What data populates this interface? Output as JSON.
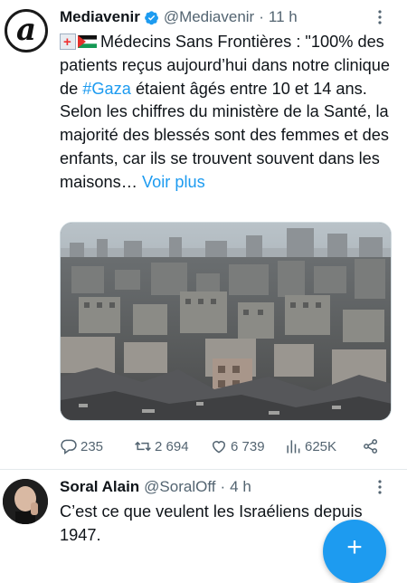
{
  "tweet": {
    "author_name": "Mediavenir",
    "author_handle": "@Mediavenir",
    "separator": "·",
    "time": "11 h",
    "avatar_glyph": "a",
    "text_prefix": "Médecins Sans Frontières : \"100% des patients reçus aujourd’hui dans notre clinique de ",
    "hashtag": "#Gaza",
    "text_suffix": " étaient âgés entre 10 et 14 ans. Selon les chiffres du ministère de la Santé, la majorité des blessés sont des femmes et des enfants, car ils se trouvent souvent dans les maisons… ",
    "show_more": "Voir plus",
    "emojis": [
      "hospital-emoji",
      "palestine-flag-emoji"
    ],
    "media_description_icon": "photo-of-destroyed-city",
    "stats": {
      "replies": "235",
      "reposts": "2 694",
      "likes": "6 739",
      "views": "625K"
    }
  },
  "reply": {
    "author_name": "Soral Alain",
    "author_handle": "@SoralOff",
    "separator": "·",
    "time": "4 h",
    "text": "C’est ce que veulent les Israéliens depuis 1947."
  },
  "fab": {
    "label": "+"
  },
  "colors": {
    "accent": "#1d9bf0",
    "text": "#0f1419",
    "secondary": "#536471"
  }
}
